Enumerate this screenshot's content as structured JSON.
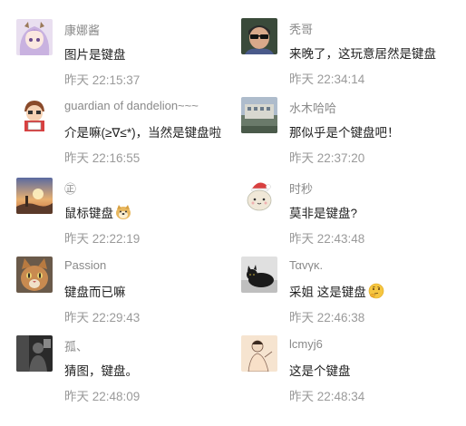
{
  "comments": [
    {
      "name": "康娜酱",
      "text": "图片是键盘",
      "time": "昨天 22:15:37",
      "avatar": "anime-girl-avatar"
    },
    {
      "name": "guardian of dandelion~~~",
      "text": "介是嘛(≥∇≤*)，当然是键盘啦",
      "time": "昨天 22:16:55",
      "avatar": "cartoon-boy-avatar"
    },
    {
      "name": "㊣",
      "text": "鼠标键盘",
      "time": "昨天 22:22:19",
      "avatar": "sunset-avatar",
      "emoji": "doge-emoji"
    },
    {
      "name": "Passion",
      "text": "键盘而已嘛",
      "time": "昨天 22:29:43",
      "avatar": "cat-avatar"
    },
    {
      "name": "孤、",
      "text": "猜图，键盘。",
      "time": "昨天 22:48:09",
      "avatar": "dark-photo-avatar"
    },
    {
      "name": "秃哥",
      "text": "来晚了，这玩意居然是键盘",
      "time": "昨天 22:34:14",
      "avatar": "sunglasses-man-avatar"
    },
    {
      "name": "水木哈哈",
      "text": "那似乎是个键盘吧！",
      "time": "昨天 22:37:20",
      "avatar": "building-avatar"
    },
    {
      "name": "时秒",
      "text": "莫非是键盘?",
      "time": "昨天 22:43:48",
      "avatar": "christmas-cat-avatar"
    },
    {
      "name": "Ταvγκ.",
      "text": "采姐 这是键盘",
      "time": "昨天 22:46:38",
      "avatar": "black-cat-avatar",
      "emoji": "thinking-emoji"
    },
    {
      "name": "lcmyj6",
      "text": "这是个键盘",
      "time": "昨天 22:48:34",
      "avatar": "sketch-avatar"
    }
  ]
}
